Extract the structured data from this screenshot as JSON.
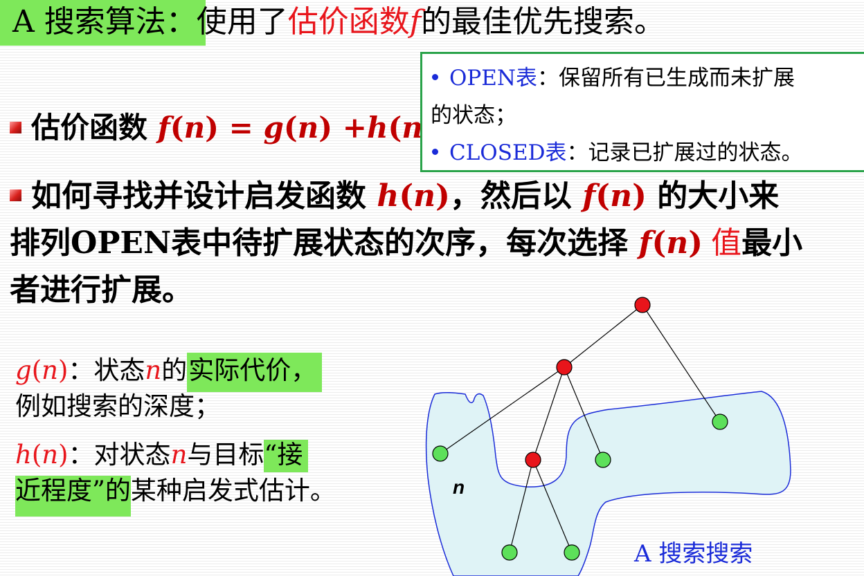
{
  "title": {
    "prefix": "A 搜索算法：",
    "middle": "使用了",
    "red": "估价函数",
    "f": "f",
    "suffix": "的最佳优先搜索。"
  },
  "formula": {
    "label": "估价函数",
    "f": "f",
    "eq": " = ",
    "g": "g",
    "plus": " +",
    "h": "h",
    "n": "n",
    "lp": "(",
    "rp": ")"
  },
  "definitions": {
    "open_term": "OPEN表",
    "open_text_1": "：保留所有已生成而未扩展",
    "open_text_2": "的状态；",
    "closed_term": "CLOSED表",
    "closed_text": "：记录已扩展过的状态。"
  },
  "paragraph": {
    "line1_a": "如何寻找并设计启发函数 ",
    "line1_b": "，然后以 ",
    "line1_c": " 的大小来",
    "line2_a": "排列",
    "line2_open": "OPEN",
    "line2_b": "表中待扩展状态的次序，每次选择 ",
    "line2_val": "值",
    "line2_c": "最小",
    "line3": "者进行扩展。"
  },
  "g_desc": {
    "g": "g",
    "n": "n",
    "sep": "：状态",
    "of": "的",
    "hl": "实际代价，",
    "line2": "例如搜索的深度；"
  },
  "h_desc": {
    "h": "h",
    "n": "n",
    "sep": "：对状态",
    "with": "与目标",
    "hl1": "“接",
    "hl2": "近程度”的",
    "rest": "某种启发式估计。"
  },
  "tree": {
    "node_label": "n",
    "region_label": "A 搜索搜索",
    "colors": {
      "expanded": "#e8151b",
      "open": "#5de05a",
      "region": "#dff3f6",
      "region_border": "#1a2bd8"
    }
  }
}
